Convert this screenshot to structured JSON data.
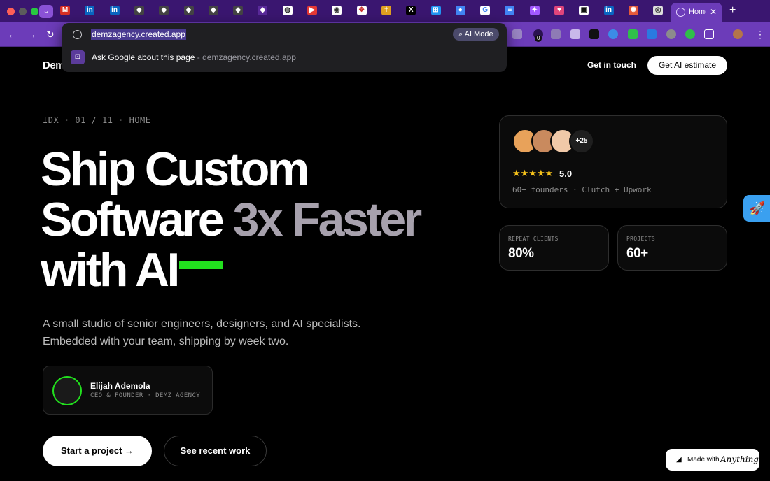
{
  "browser": {
    "active_tab_title": "Home",
    "omnibox": {
      "url": "demzagency.created.app",
      "ai_mode_label": "AI Mode",
      "suggestion_text": "Ask Google about this page",
      "suggestion_url": " - demzagency.created.app"
    },
    "extension_badge": "0",
    "favicon_labels": [
      "M",
      "in",
      "in",
      "◆",
      "◆",
      "◆",
      "◆",
      "◆",
      "◆",
      "◍",
      "▶",
      "◉",
      "❖",
      "ǂ",
      "X",
      "⊞",
      "●",
      "G",
      "≡",
      "✦",
      "♥",
      "▣",
      "in",
      "✺",
      "◎"
    ]
  },
  "nav": {
    "logo": "Demz",
    "link": "Get in touch",
    "cta": "Get AI estimate"
  },
  "hero": {
    "eyebrow": "IDX · 01 / 11 · HOME",
    "headline_line1": "Ship Custom",
    "headline_line2_a": "Software ",
    "headline_line2_b": "3x Faster",
    "headline_line3": "with AI",
    "subtitle_line1": "A small studio of senior engineers, designers, and AI specialists.",
    "subtitle_line2": "Embedded with your team, shipping by week two.",
    "founder_name": "Elijah Ademola",
    "founder_role": "CEO & FOUNDER · DEMZ AGENCY",
    "primary_button": "Start a project →",
    "secondary_button": "See recent work"
  },
  "rating": {
    "more_count": "+25",
    "stars": "★★★★★",
    "score": "5.0",
    "meta": "60+ founders · Clutch + Upwork"
  },
  "stats": [
    {
      "label": "REPEAT CLIENTS",
      "value": "80%"
    },
    {
      "label": "PROJECTS",
      "value": "60+"
    }
  ],
  "badge": {
    "prefix": "Made with",
    "brand": "Anything"
  },
  "colors": {
    "accent_green": "#22e01e",
    "browser_purple": "#6c3cb9",
    "star_yellow": "#f6c21b"
  }
}
